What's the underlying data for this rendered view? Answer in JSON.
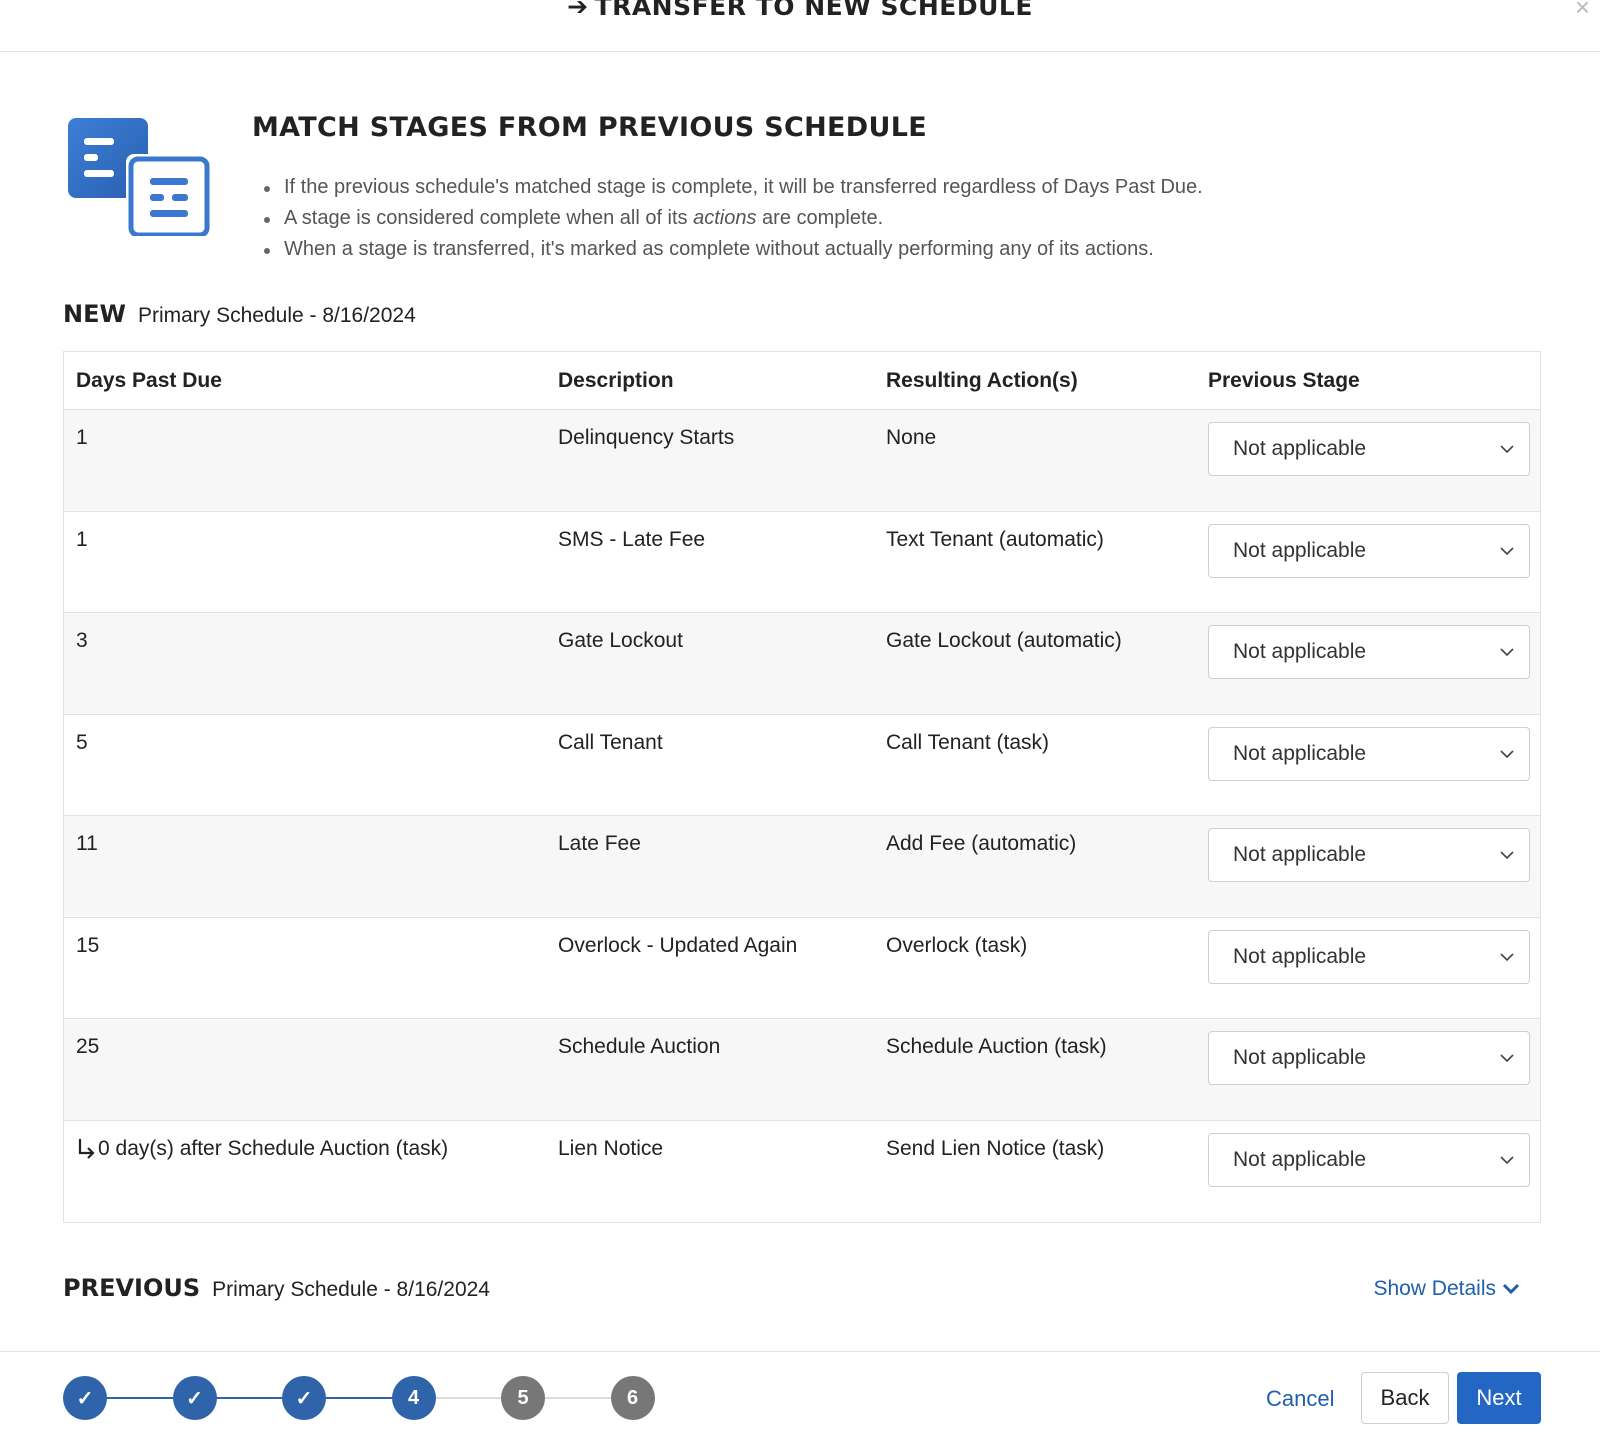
{
  "modal": {
    "title": "TRANSFER TO NEW SCHEDULE",
    "close_symbol": "×"
  },
  "intro": {
    "icon": "documents-icon",
    "title": "MATCH STAGES FROM PREVIOUS SCHEDULE",
    "bullet1": "If the previous schedule's matched stage is complete, it will be transferred regardless of Days Past Due.",
    "bullet2_pre": "A stage is considered complete when all of its ",
    "bullet2_em": "actions",
    "bullet2_post": " are complete.",
    "bullet3": "When a stage is transferred, it's marked as complete without actually performing any of its actions."
  },
  "new_section": {
    "tag": "NEW",
    "schedule": "Primary Schedule - 8/16/2024"
  },
  "table": {
    "headers": {
      "days": "Days Past Due",
      "description": "Description",
      "actions": "Resulting Action(s)",
      "previous": "Previous Stage"
    },
    "rows": [
      {
        "days": "1",
        "description": "Delinquency Starts",
        "actions": "None",
        "previous": "Not applicable"
      },
      {
        "days": "1",
        "description": "SMS - Late Fee",
        "actions": "Text Tenant (automatic)",
        "previous": "Not applicable"
      },
      {
        "days": "3",
        "description": "Gate Lockout",
        "actions": "Gate Lockout (automatic)",
        "previous": "Not applicable"
      },
      {
        "days": "5",
        "description": "Call Tenant",
        "actions": "Call Tenant (task)",
        "previous": "Not applicable"
      },
      {
        "days": "11",
        "description": "Late Fee",
        "actions": "Add Fee (automatic)",
        "previous": "Not applicable"
      },
      {
        "days": "15",
        "description": "Overlock - Updated Again",
        "actions": "Overlock (task)",
        "previous": "Not applicable"
      },
      {
        "days": "25",
        "description": "Schedule Auction",
        "actions": "Schedule Auction (task)",
        "previous": "Not applicable"
      },
      {
        "days": "0 day(s) after Schedule Auction (task)",
        "description": "Lien Notice",
        "actions": "Send Lien Notice (task)",
        "previous": "Not applicable"
      }
    ]
  },
  "previous_section": {
    "tag": "PREVIOUS",
    "schedule": "Primary Schedule - 8/16/2024",
    "show_details": "Show Details"
  },
  "stepper": {
    "steps": [
      {
        "label": "✓",
        "state": "done"
      },
      {
        "label": "✓",
        "state": "done"
      },
      {
        "label": "✓",
        "state": "done"
      },
      {
        "label": "4",
        "state": "current"
      },
      {
        "label": "5",
        "state": "todo"
      },
      {
        "label": "6",
        "state": "todo"
      }
    ]
  },
  "footer": {
    "cancel": "Cancel",
    "back": "Back",
    "next": "Next"
  },
  "colors": {
    "primary": "#2466c4",
    "step_done": "#2f64aa",
    "step_todo": "#777777",
    "link": "#1f5fae"
  }
}
